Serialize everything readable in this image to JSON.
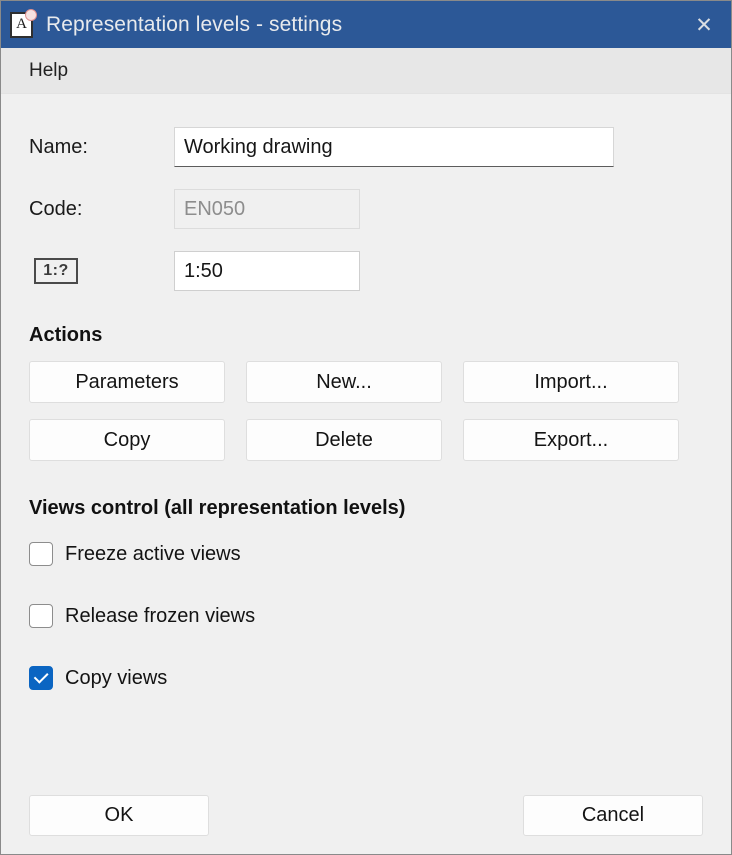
{
  "window": {
    "title": "Representation levels - settings",
    "app_icon": "document-a-icon",
    "close_label": "✕",
    "titlebar_color": "#2c5897",
    "accent_color": "#0b65c2"
  },
  "menubar": {
    "items": [
      {
        "label": "Help",
        "name": "menu-item-help"
      }
    ]
  },
  "form": {
    "name": {
      "label": "Name:",
      "value": "Working drawing",
      "placeholder": ""
    },
    "code": {
      "label": "Code:",
      "value": "EN050",
      "placeholder": "",
      "disabled": true
    },
    "scale": {
      "icon_label": "1:?",
      "value": "1:50",
      "placeholder": ""
    }
  },
  "actions": {
    "title": "Actions",
    "buttons": [
      {
        "label": "Parameters",
        "name": "parameters-button"
      },
      {
        "label": "New...",
        "name": "new-button"
      },
      {
        "label": "Import...",
        "name": "import-button"
      },
      {
        "label": "Copy",
        "name": "copy-button"
      },
      {
        "label": "Delete",
        "name": "delete-button"
      },
      {
        "label": "Export...",
        "name": "export-button"
      }
    ]
  },
  "views_control": {
    "title": "Views control (all representation levels)",
    "checkboxes": [
      {
        "label": "Freeze active views",
        "checked": false,
        "name": "checkbox-freeze-active-views"
      },
      {
        "label": "Release frozen views",
        "checked": false,
        "name": "checkbox-release-frozen-views"
      },
      {
        "label": "Copy views",
        "checked": true,
        "name": "checkbox-copy-views"
      }
    ]
  },
  "footer": {
    "ok_label": "OK",
    "cancel_label": "Cancel"
  }
}
